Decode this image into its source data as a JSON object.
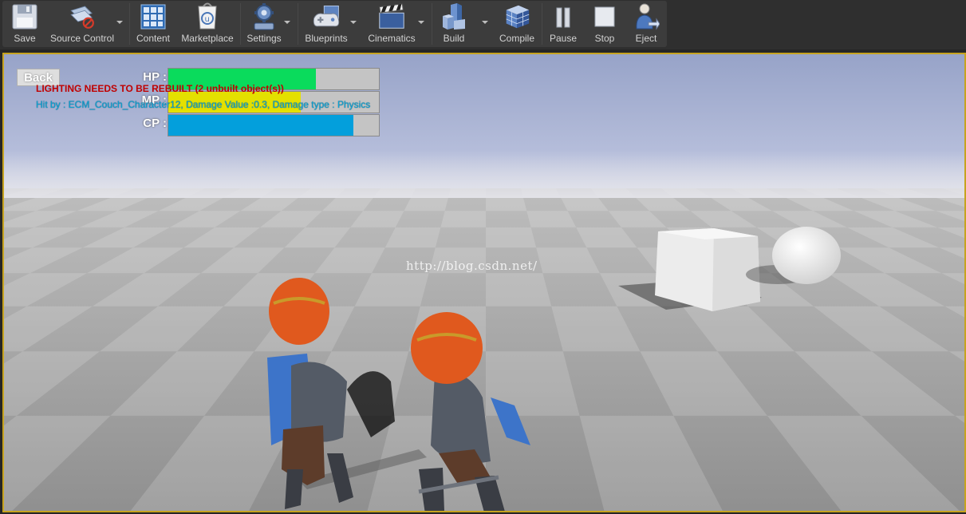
{
  "toolbar": {
    "save": "Save",
    "source_control": "Source Control",
    "content": "Content",
    "marketplace": "Marketplace",
    "settings": "Settings",
    "blueprints": "Blueprints",
    "cinematics": "Cinematics",
    "build": "Build",
    "compile": "Compile",
    "pause": "Pause",
    "stop": "Stop",
    "eject": "Eject"
  },
  "hud": {
    "back": "Back",
    "stats": [
      {
        "label": "HP :",
        "fill": 0.7,
        "color": "#0adb5c"
      },
      {
        "label": "MP :",
        "fill": 0.63,
        "color": "#e4e000"
      },
      {
        "label": "CP :",
        "fill": 0.88,
        "color": "#039fdc"
      }
    ],
    "lighting_warning": "LIGHTING NEEDS TO BE REBUILT (2 unbuilt object(s))",
    "hit_message": "Hit by : ECM_Couch_Character12, Damage Value :0.3, Damage type : Physics"
  },
  "watermark": "http://blog.csdn.net/"
}
